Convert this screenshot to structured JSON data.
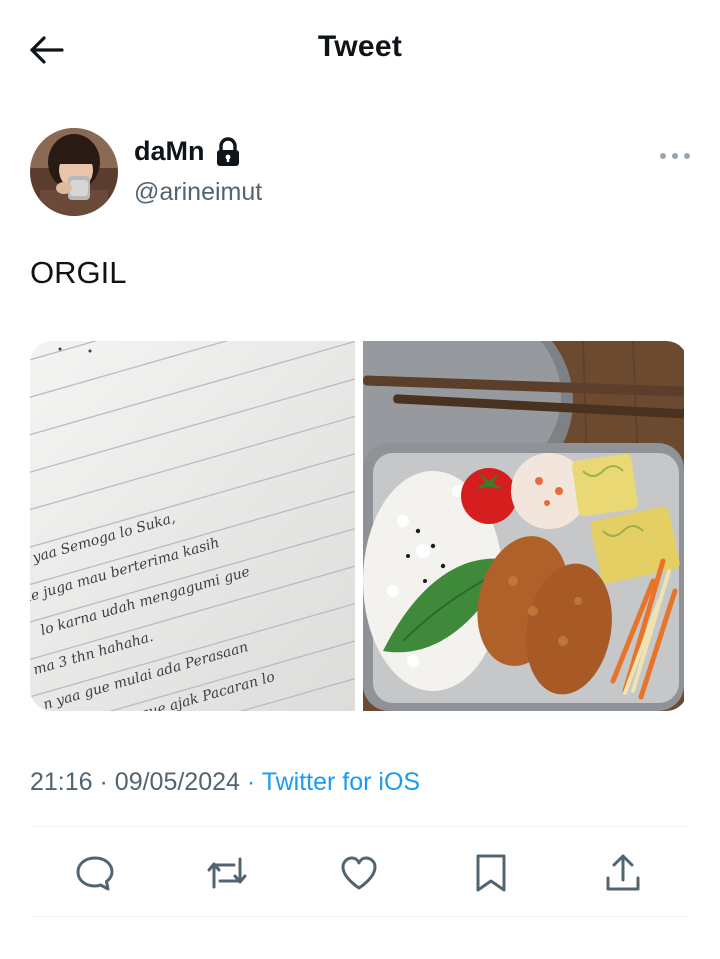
{
  "header": {
    "title": "Tweet",
    "back_icon": "arrow-left-icon"
  },
  "author": {
    "display_name": "daMn",
    "handle": "@arineimut",
    "protected_icon": "lock-icon",
    "more_icon": "more-horizontal-icon"
  },
  "tweet": {
    "text": "ORGIL",
    "time": "21:16",
    "date": "09/05/2024",
    "separator": "·",
    "source": "Twitter for iOS"
  },
  "media": {
    "items": [
      {
        "kind": "handwritten-note",
        "lines": [
          "e ̈",
          "kan yaa Semoga lo Suka,",
          "gue juga mau berterima kasih",
          "lo karna udah mengagumi gue",
          "ma 3 thn hahaha.",
          "n yaa gue mulai ada Perasaan",
          "ama lo, kalo gue ajak Pacaran lo"
        ]
      },
      {
        "kind": "bento-photo"
      }
    ]
  },
  "actions": {
    "reply_icon": "reply-icon",
    "retweet_icon": "retweet-icon",
    "like_icon": "heart-icon",
    "bookmark_icon": "bookmark-icon",
    "share_icon": "share-icon"
  },
  "colors": {
    "text": "#0f1419",
    "secondary": "#536471",
    "accent": "#1d9bf0",
    "divider": "#eff3f4"
  }
}
